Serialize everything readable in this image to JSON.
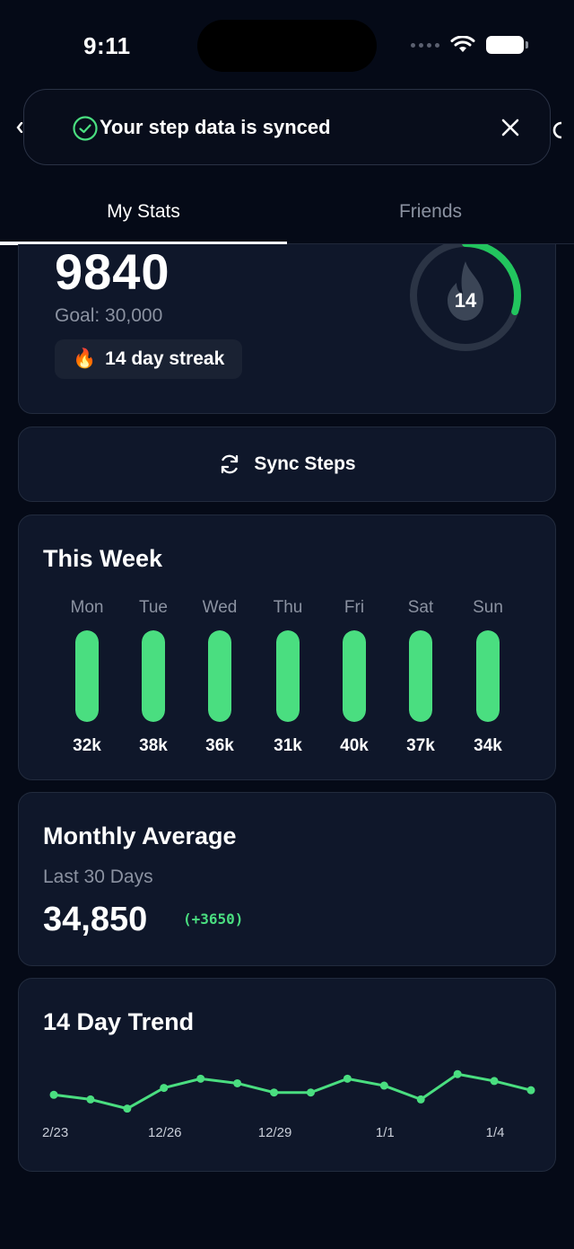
{
  "status_bar": {
    "time": "9:11"
  },
  "toast": {
    "message": "Your step data is synced"
  },
  "tabs": [
    {
      "label": "My Stats",
      "active": true
    },
    {
      "label": "Friends",
      "active": false
    }
  ],
  "stats": {
    "steps": "9840",
    "goal": "Goal: 30,000",
    "streak_emoji": "🔥",
    "streak_label": "14 day streak",
    "ring_value": "14",
    "ring_progress": 0.3
  },
  "sync": {
    "label": "Sync Steps"
  },
  "week": {
    "title": "This Week",
    "days": [
      {
        "day": "Mon",
        "label": "32k",
        "fill": 1.0
      },
      {
        "day": "Tue",
        "label": "38k",
        "fill": 1.0
      },
      {
        "day": "Wed",
        "label": "36k",
        "fill": 1.0
      },
      {
        "day": "Thu",
        "label": "31k",
        "fill": 1.0
      },
      {
        "day": "Fri",
        "label": "40k",
        "fill": 1.0
      },
      {
        "day": "Sat",
        "label": "37k",
        "fill": 1.0
      },
      {
        "day": "Sun",
        "label": "34k",
        "fill": 1.0
      }
    ]
  },
  "monthly": {
    "title": "Monthly Average",
    "subtitle": "Last 30 Days",
    "value": "34,850",
    "delta": "(+3650)"
  },
  "trend": {
    "title": "14 Day Trend",
    "x_labels": [
      "2/23",
      "12/26",
      "12/29",
      "1/1",
      "1/4"
    ],
    "accent": "#4ade80"
  },
  "chart_data": {
    "type": "line",
    "title": "14 Day Trend",
    "x_tick_labels": [
      "2/23",
      "12/26",
      "12/29",
      "1/1",
      "1/4"
    ],
    "series": [
      {
        "values": [
          32,
          30,
          26,
          35,
          39,
          37,
          33,
          33,
          39,
          36,
          30,
          41,
          38,
          34
        ]
      }
    ],
    "ylim": [
      20,
      45
    ],
    "grid": false
  },
  "colors": {
    "background": "#050a17",
    "card": "#0f172a",
    "accent": "#4ade80",
    "muted": "#8b92a1"
  }
}
